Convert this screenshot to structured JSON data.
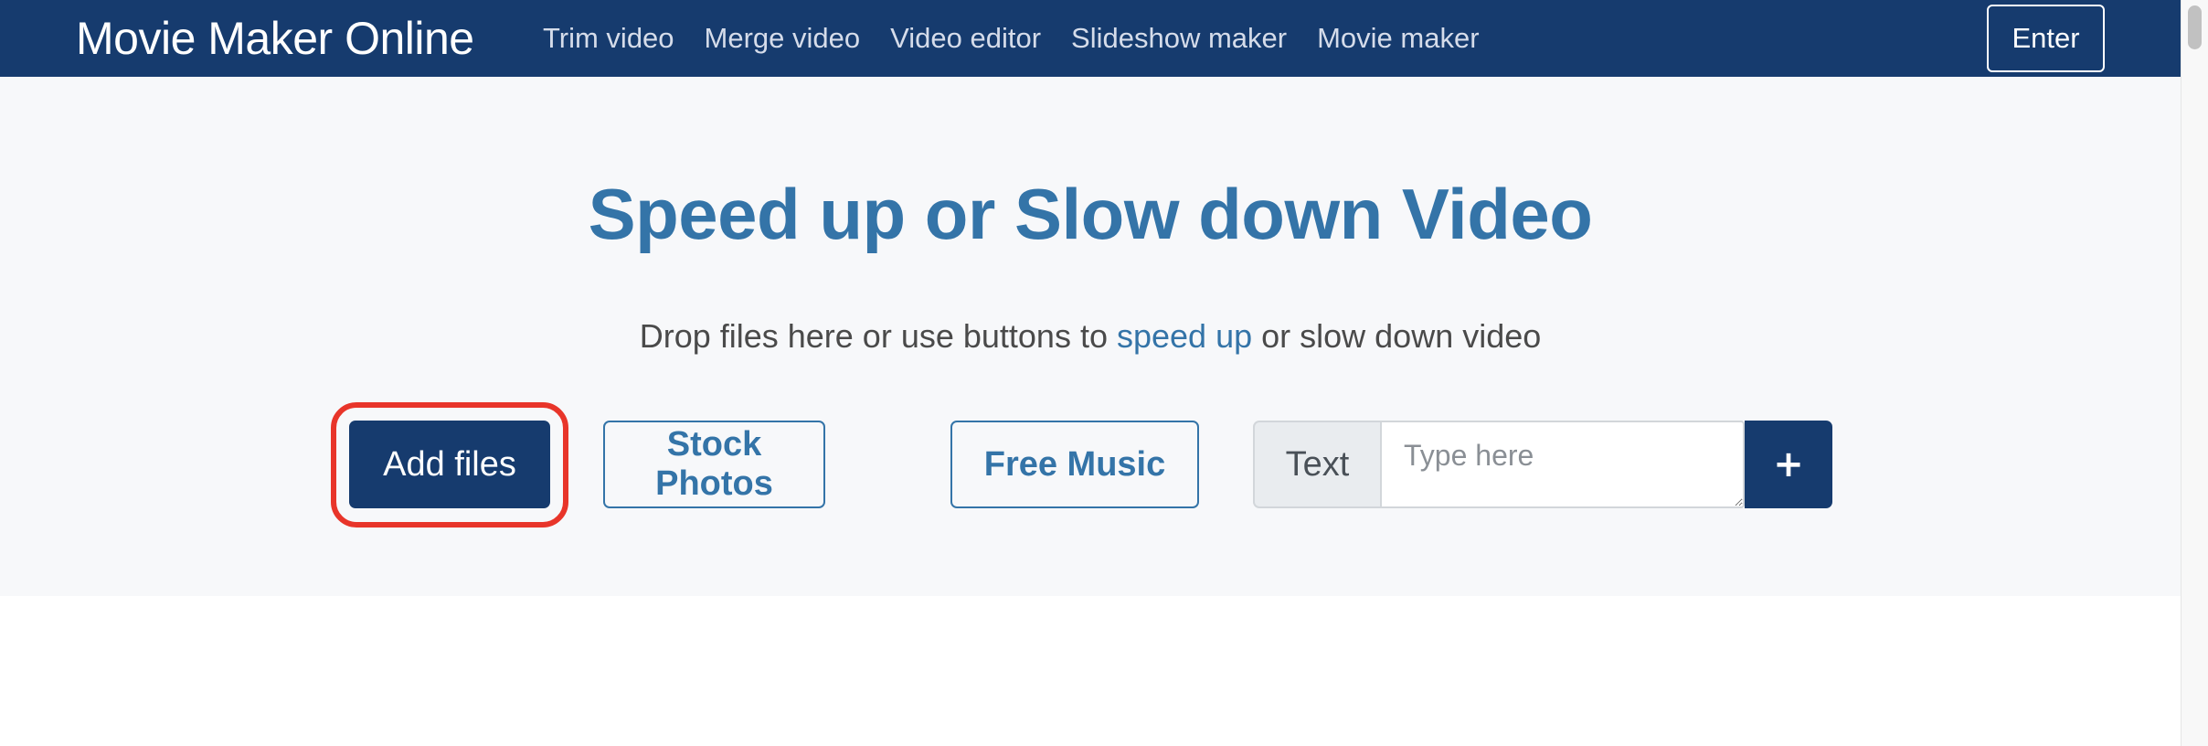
{
  "header": {
    "brand": "Movie Maker Online",
    "nav": [
      {
        "label": "Trim video"
      },
      {
        "label": "Merge video"
      },
      {
        "label": "Video editor"
      },
      {
        "label": "Slideshow maker"
      },
      {
        "label": "Movie maker"
      }
    ],
    "enter_label": "Enter"
  },
  "hero": {
    "title": "Speed up or Slow down Video",
    "subtitle_before": "Drop files here or use buttons to ",
    "subtitle_link": "speed up",
    "subtitle_after": " or slow down video",
    "add_files_label": "Add files",
    "stock_photos_label": "Stock Photos",
    "free_music_label": "Free Music",
    "text_label": "Text",
    "text_input": {
      "value": "",
      "placeholder": "Type here"
    },
    "add_text_label": "+"
  },
  "colors": {
    "navbar": "#163b6e",
    "accent": "#3474a8",
    "highlight": "#e8352a",
    "hero_bg": "#f7f8fa"
  }
}
